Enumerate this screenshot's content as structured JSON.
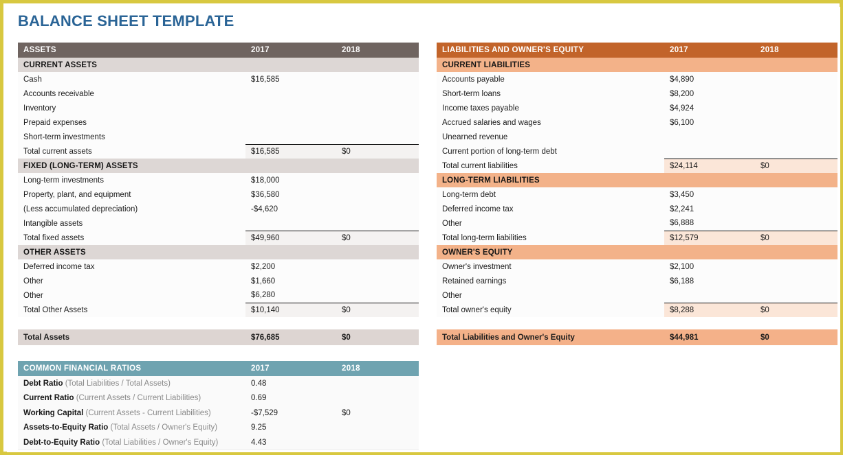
{
  "document": {
    "title": "BALANCE SHEET TEMPLATE",
    "title_color": "#2a6496",
    "border_color": "#d8c840"
  },
  "assets_table": {
    "header": {
      "label": "ASSETS",
      "year1": "2017",
      "year2": "2018",
      "color": "#6f6460"
    },
    "sections": [
      {
        "name": "CURRENT ASSETS",
        "rows": [
          {
            "label": "Cash",
            "y1": "$16,585",
            "y2": ""
          },
          {
            "label": "Accounts receivable",
            "y1": "",
            "y2": ""
          },
          {
            "label": "Inventory",
            "y1": "",
            "y2": ""
          },
          {
            "label": "Prepaid expenses",
            "y1": "",
            "y2": ""
          },
          {
            "label": "Short-term investments",
            "y1": "",
            "y2": ""
          }
        ],
        "subtotal": {
          "label": "Total current assets",
          "y1": "$16,585",
          "y2": "$0"
        }
      },
      {
        "name": "FIXED (LONG-TERM) ASSETS",
        "rows": [
          {
            "label": "Long-term investments",
            "y1": "$18,000",
            "y2": ""
          },
          {
            "label": "Property, plant, and equipment",
            "y1": "$36,580",
            "y2": ""
          },
          {
            "label": "(Less accumulated depreciation)",
            "y1": "-$4,620",
            "y2": ""
          },
          {
            "label": "Intangible assets",
            "y1": "",
            "y2": ""
          }
        ],
        "subtotal": {
          "label": "Total fixed assets",
          "y1": "$49,960",
          "y2": "$0"
        }
      },
      {
        "name": "OTHER ASSETS",
        "rows": [
          {
            "label": "Deferred income tax",
            "y1": "$2,200",
            "y2": ""
          },
          {
            "label": "Other",
            "y1": "$1,660",
            "y2": ""
          },
          {
            "label": "Other",
            "y1": "$6,280",
            "y2": ""
          }
        ],
        "subtotal": {
          "label": "Total Other Assets",
          "y1": "$10,140",
          "y2": "$0"
        }
      }
    ],
    "grand_total": {
      "label": "Total Assets",
      "y1": "$76,685",
      "y2": "$0"
    }
  },
  "liabilities_table": {
    "header": {
      "label": "LIABILITIES AND OWNER'S EQUITY",
      "year1": "2017",
      "year2": "2018",
      "color": "#c2642a"
    },
    "sections": [
      {
        "name": "CURRENT LIABILITIES",
        "rows": [
          {
            "label": "Accounts payable",
            "y1": "$4,890",
            "y2": ""
          },
          {
            "label": "Short-term loans",
            "y1": "$8,200",
            "y2": ""
          },
          {
            "label": "Income taxes payable",
            "y1": "$4,924",
            "y2": ""
          },
          {
            "label": "Accrued salaries and wages",
            "y1": "$6,100",
            "y2": ""
          },
          {
            "label": "Unearned revenue",
            "y1": "",
            "y2": ""
          },
          {
            "label": "Current portion of long-term debt",
            "y1": "",
            "y2": ""
          }
        ],
        "subtotal": {
          "label": "Total current liabilities",
          "y1": "$24,114",
          "y2": "$0"
        }
      },
      {
        "name": "LONG-TERM LIABILITIES",
        "rows": [
          {
            "label": "Long-term debt",
            "y1": "$3,450",
            "y2": ""
          },
          {
            "label": "Deferred income tax",
            "y1": "$2,241",
            "y2": ""
          },
          {
            "label": "Other",
            "y1": "$6,888",
            "y2": ""
          }
        ],
        "subtotal": {
          "label": "Total long-term liabilities",
          "y1": "$12,579",
          "y2": "$0"
        }
      },
      {
        "name": "OWNER'S EQUITY",
        "rows": [
          {
            "label": "Owner's investment",
            "y1": "$2,100",
            "y2": ""
          },
          {
            "label": "Retained earnings",
            "y1": "$6,188",
            "y2": ""
          },
          {
            "label": "Other",
            "y1": "",
            "y2": ""
          }
        ],
        "subtotal": {
          "label": "Total owner's equity",
          "y1": "$8,288",
          "y2": "$0"
        }
      }
    ],
    "grand_total": {
      "label": "Total Liabilities and Owner's Equity",
      "y1": "$44,981",
      "y2": "$0"
    }
  },
  "ratios_table": {
    "header": {
      "label": "COMMON FINANCIAL RATIOS",
      "year1": "2017",
      "year2": "2018",
      "color": "#6fa3b0"
    },
    "rows": [
      {
        "name": "Debt Ratio",
        "formula": "(Total Liabilities / Total Assets)",
        "y1": "0.48",
        "y2": ""
      },
      {
        "name": "Current Ratio",
        "formula": "(Current Assets / Current Liabilities)",
        "y1": "0.69",
        "y2": ""
      },
      {
        "name": "Working Capital",
        "formula": "(Current Assets - Current Liabilities)",
        "y1": "-$7,529",
        "y2": "$0"
      },
      {
        "name": "Assets-to-Equity Ratio",
        "formula": "(Total Assets / Owner's Equity)",
        "y1": "9.25",
        "y2": ""
      },
      {
        "name": "Debt-to-Equity Ratio",
        "formula": "(Total Liabilities / Owner's Equity)",
        "y1": "4.43",
        "y2": ""
      }
    ]
  }
}
